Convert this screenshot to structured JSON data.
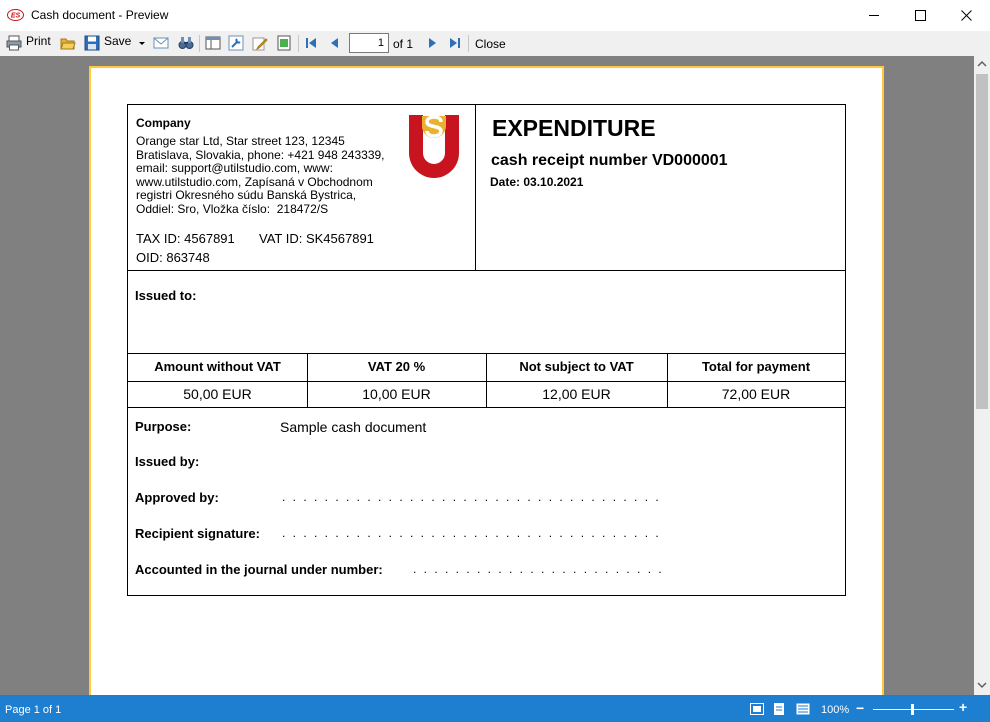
{
  "window": {
    "title": "Cash document - Preview",
    "app_badge": "ES"
  },
  "toolbar": {
    "print_label": "Print",
    "save_label": "Save",
    "page_value": "1",
    "page_of": "of 1",
    "close_label": "Close"
  },
  "document": {
    "company": {
      "title": "Company",
      "address": "Orange star Ltd, Star street 123, 12345\nBratislava, Slovakia, phone: +421 948 243339,\nemail: support@utilstudio.com, www:\nwww.utilstudio.com, Zapísaná v Obchodnom\nregistri Okresného súdu Banská Bystrica,\nOddiel: Sro, Vložka číslo:  218472/S",
      "tax_id": "TAX ID: 4567891",
      "vat_id": "VAT ID: SK4567891",
      "oid": "OID: 863748"
    },
    "title": "EXPENDITURE",
    "receipt_number": "cash receipt number VD000001",
    "date": "Date: 03.10.2021",
    "issued_to_label": "Issued to:",
    "table": {
      "headers": [
        "Amount without VAT",
        "VAT 20 %",
        "Not subject to VAT",
        "Total for payment"
      ],
      "values": [
        "50,00 EUR",
        "10,00 EUR",
        "12,00 EUR",
        "72,00 EUR"
      ]
    },
    "purpose_label": "Purpose:",
    "purpose_value": "Sample cash document",
    "issued_by_label": "Issued by:",
    "approved_by_label": "Approved by:",
    "approved_by_dots": ". . . . . . . . . . . . . . . . . . . . . . . . . . . . . . . . . . . .",
    "recipient_label": "Recipient signature:",
    "recipient_dots": ". . . . . . . . . . . . . . . . . . . . . . . . . . . . . . . . . . . .",
    "journal_label": "Accounted in the journal under number:",
    "journal_dots": ". . . . . . . . . . . . . . . . . . . . . . . ."
  },
  "status": {
    "page_text": "Page 1 of 1",
    "zoom": "100%",
    "zoom_level_percent": 100
  },
  "colors": {
    "accent": "#1e7ecf",
    "paper_border": "#ffc83d",
    "logo_red": "#c8141e"
  }
}
